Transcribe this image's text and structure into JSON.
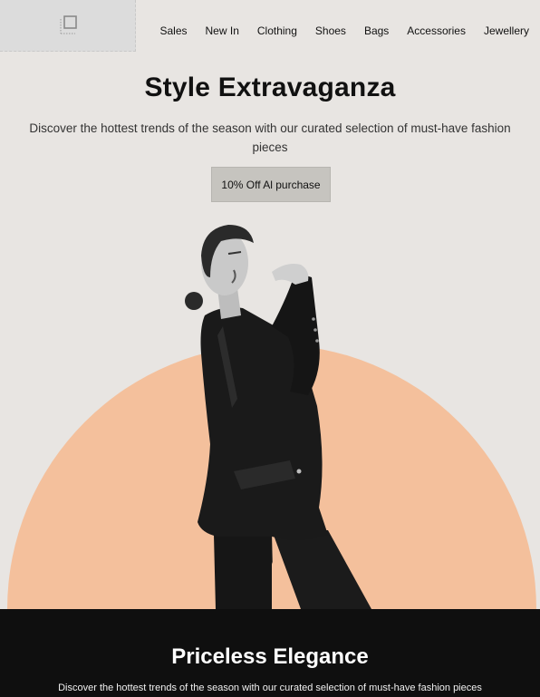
{
  "header": {
    "logo_icon": "image-placeholder-icon",
    "nav": [
      "Sales",
      "New In",
      "Clothing",
      "Shoes",
      "Bags",
      "Accessories",
      "Jewellery"
    ]
  },
  "hero": {
    "title": "Style Extravaganza",
    "subtitle": "Discover the hottest trends of the season with our curated selection of must-have fashion pieces",
    "cta_label": "10% Off Al purchase",
    "accent_color": "#f4c09c",
    "cta_color": "#c6c4bf",
    "background_color": "#e8e5e2"
  },
  "section2": {
    "title": "Priceless Elegance",
    "subtitle": "Discover the hottest trends of the season with our curated selection of must-have fashion pieces",
    "background_color": "#0f0f0f"
  }
}
